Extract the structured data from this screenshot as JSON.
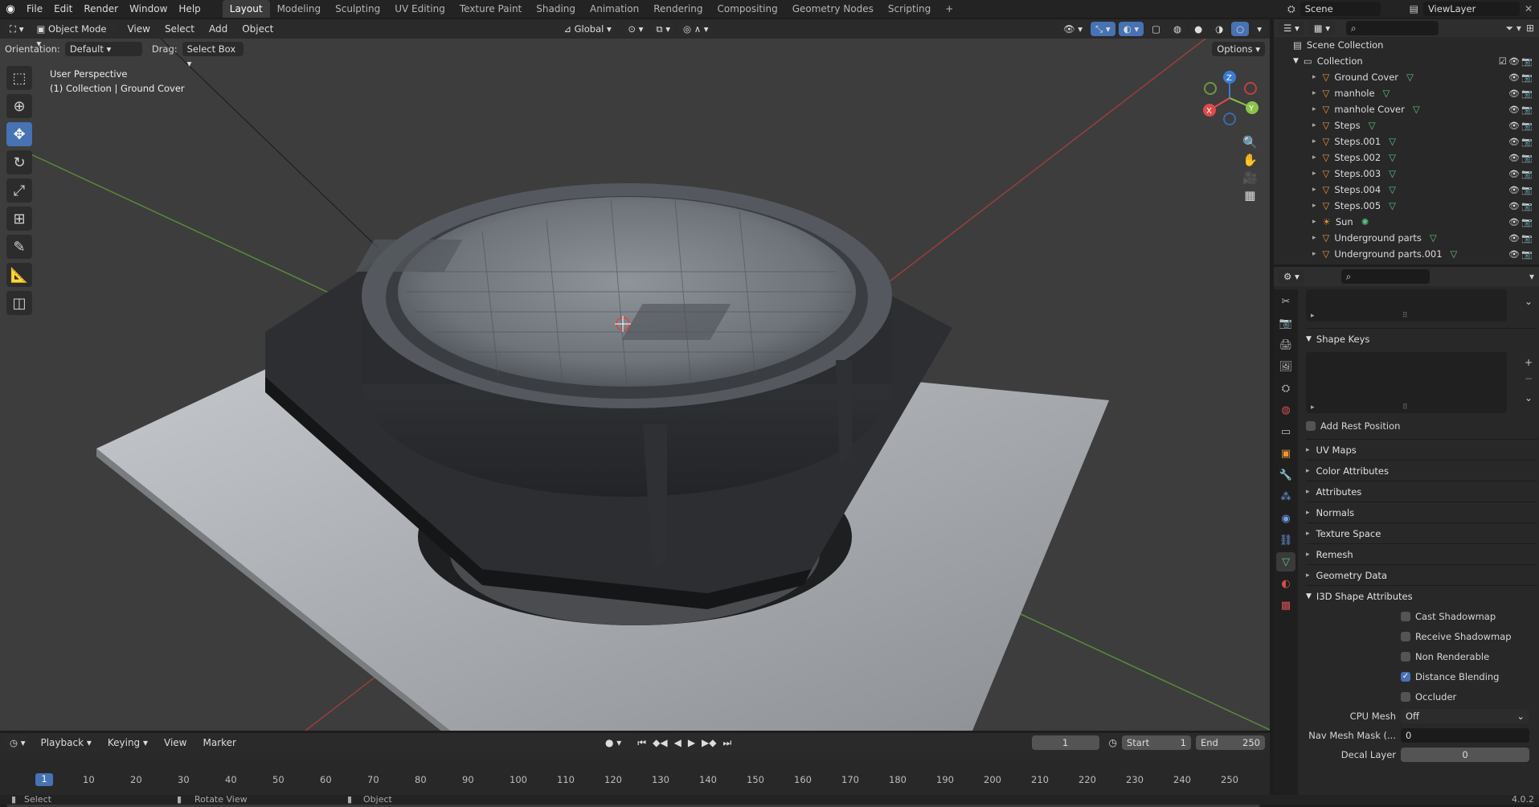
{
  "menus": [
    "File",
    "Edit",
    "Render",
    "Window",
    "Help"
  ],
  "workspaces": [
    "Layout",
    "Modeling",
    "Sculpting",
    "UV Editing",
    "Texture Paint",
    "Shading",
    "Animation",
    "Rendering",
    "Compositing",
    "Geometry Nodes",
    "Scripting"
  ],
  "scene": "Scene",
  "view_layer": "ViewLayer",
  "viewport": {
    "mode": "Object Mode",
    "menus": [
      "View",
      "Select",
      "Add",
      "Object"
    ],
    "orientation_transform": "Global",
    "orientation_label": "Orientation:",
    "orientation_value": "Default",
    "drag_label": "Drag:",
    "drag_value": "Select Box",
    "options": "Options",
    "overlay_line1": "User Perspective",
    "overlay_line2": "(1) Collection | Ground Cover",
    "gizmo_axes": [
      "X",
      "Y",
      "Z"
    ]
  },
  "outliner": {
    "root": "Scene Collection",
    "collection": "Collection",
    "items": [
      {
        "name": "Ground Cover",
        "type": "mesh"
      },
      {
        "name": "manhole",
        "type": "mesh"
      },
      {
        "name": "manhole Cover",
        "type": "mesh"
      },
      {
        "name": "Steps",
        "type": "mesh"
      },
      {
        "name": "Steps.001",
        "type": "mesh"
      },
      {
        "name": "Steps.002",
        "type": "mesh"
      },
      {
        "name": "Steps.003",
        "type": "mesh"
      },
      {
        "name": "Steps.004",
        "type": "mesh"
      },
      {
        "name": "Steps.005",
        "type": "mesh"
      },
      {
        "name": "Sun",
        "type": "light"
      },
      {
        "name": "Underground parts",
        "type": "mesh"
      },
      {
        "name": "Underground parts.001",
        "type": "mesh"
      }
    ]
  },
  "properties": {
    "shape_keys": "Shape Keys",
    "add_rest_position": "Add Rest Position",
    "panels": [
      "UV Maps",
      "Color Attributes",
      "Attributes",
      "Normals",
      "Texture Space",
      "Remesh",
      "Geometry Data"
    ],
    "i3d_panel": "I3D Shape Attributes",
    "i3d_checks": [
      {
        "label": "Cast Shadowmap",
        "on": false
      },
      {
        "label": "Receive Shadowmap",
        "on": false
      },
      {
        "label": "Non Renderable",
        "on": false
      },
      {
        "label": "Distance Blending",
        "on": true
      },
      {
        "label": "Occluder",
        "on": false
      }
    ],
    "cpu_mesh_label": "CPU Mesh",
    "cpu_mesh_value": "Off",
    "nav_mesh_label": "Nav Mesh Mask (...",
    "nav_mesh_value": "0",
    "decal_label": "Decal Layer",
    "decal_value": "0"
  },
  "timeline": {
    "menus": [
      "Playback",
      "Keying",
      "View",
      "Marker"
    ],
    "current_frame": "1",
    "start_label": "Start",
    "start": "1",
    "end_label": "End",
    "end": "250",
    "ticks": [
      "10",
      "20",
      "30",
      "40",
      "50",
      "60",
      "70",
      "80",
      "90",
      "100",
      "110",
      "120",
      "130",
      "140",
      "150",
      "160",
      "170",
      "180",
      "190",
      "200",
      "210",
      "220",
      "230",
      "240",
      "250"
    ],
    "playhead": "1"
  },
  "status": {
    "select": "Select",
    "rotate": "Rotate View",
    "object": "Object",
    "version": "4.0.2"
  }
}
